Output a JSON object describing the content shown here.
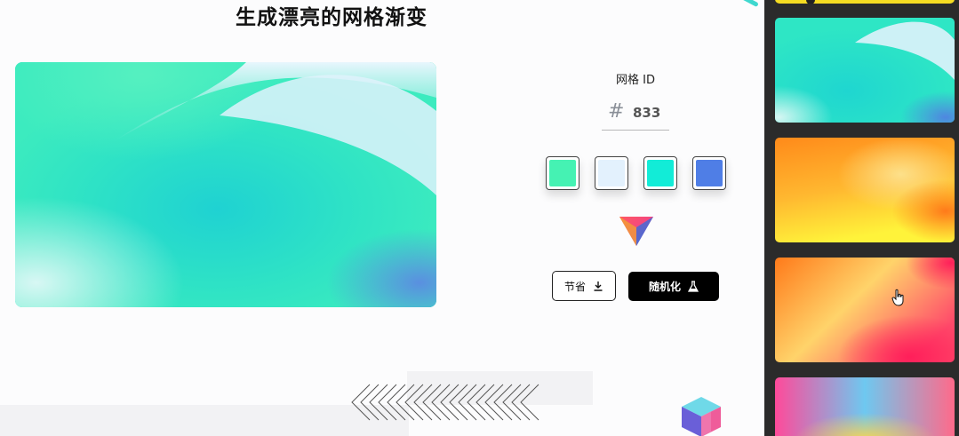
{
  "page": {
    "title": "生成漂亮的网格渐变"
  },
  "controls": {
    "mesh_label": "网格 ID",
    "hash_symbol": "#",
    "mesh_id": "833",
    "swatches": [
      {
        "name": "swatch-1",
        "color": "#45f2b3"
      },
      {
        "name": "swatch-2",
        "color": "#e3f1fd"
      },
      {
        "name": "swatch-3",
        "color": "#12ecd7"
      },
      {
        "name": "swatch-4",
        "color": "#4f7ee6"
      }
    ],
    "save_label": "节省",
    "randomize_label": "随机化"
  },
  "icons": {
    "save": "download-icon",
    "randomize": "flask-icon",
    "logo": "prism-logo-icon"
  },
  "sidebar": {
    "thumbnails": [
      {
        "name": "top-partial-thumbnail",
        "colors": [
          "#f5dc22",
          "#f5dc22"
        ]
      },
      {
        "name": "cyan-mesh-thumbnail",
        "colors": [
          "#2ee6c5",
          "#dff2fb",
          "#4f86e0"
        ]
      },
      {
        "name": "yellow-orange-mesh-thumbnail",
        "colors": [
          "#fff33a",
          "#ff8a1a",
          "#fde08a"
        ]
      },
      {
        "name": "orange-pink-mesh-thumbnail",
        "colors": [
          "#ff7a1a",
          "#ffd36a",
          "#ff1f5a"
        ]
      },
      {
        "name": "blue-pink-mesh-thumbnail",
        "colors": [
          "#ff4a9a",
          "#6ec8f0",
          "#ffd44a"
        ]
      }
    ]
  }
}
